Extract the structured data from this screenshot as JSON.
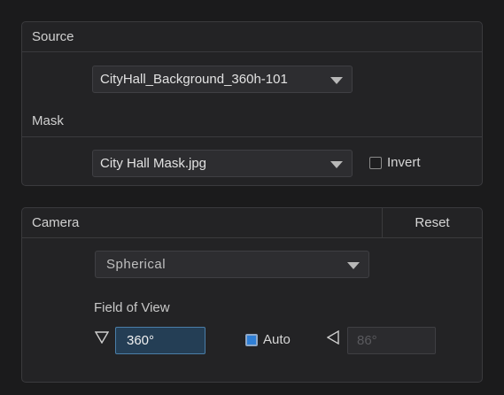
{
  "source_panel": {
    "header": "Source",
    "source_select": {
      "value": "CityHall_Background_360h-101"
    },
    "mask_label": "Mask",
    "mask_select": {
      "value": "City Hall Mask.jpg"
    },
    "invert": {
      "label": "Invert",
      "checked": false
    }
  },
  "camera_panel": {
    "header": "Camera",
    "reset_label": "Reset",
    "projection_select": {
      "value": "Spherical"
    },
    "fov_label": "Field of View",
    "fov_value": "360°",
    "auto": {
      "label": "Auto",
      "checked": true
    },
    "vertical_fov_value": "86°",
    "icons": [
      "fov-triangle-down-icon",
      "fov-triangle-left-icon"
    ]
  }
}
